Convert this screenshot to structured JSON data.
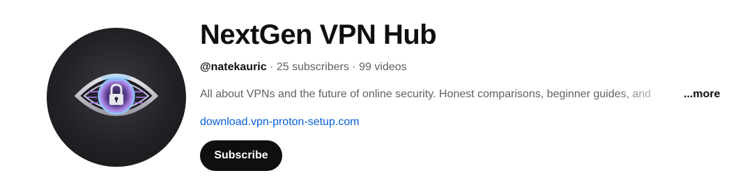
{
  "channel": {
    "name": "NextGen VPN Hub",
    "handle": "@natekauric",
    "separator": "·",
    "subscribers": "25 subscribers",
    "videos": "99 videos",
    "description": "All about VPNs and the future of online security. Honest comparisons, beginner guides, and",
    "more_label": "...more",
    "link": "download.vpn-proton-setup.com",
    "subscribe_label": "Subscribe"
  },
  "avatar": {
    "icon": "eye-lock-icon",
    "background": "#222226",
    "iris_color": "#b48ae8",
    "glow_color": "#7ec8ff"
  },
  "colors": {
    "text_primary": "#0f0f0f",
    "text_secondary": "#606060",
    "link": "#065fd4",
    "button_bg": "#0f0f0f",
    "button_text": "#ffffff"
  }
}
